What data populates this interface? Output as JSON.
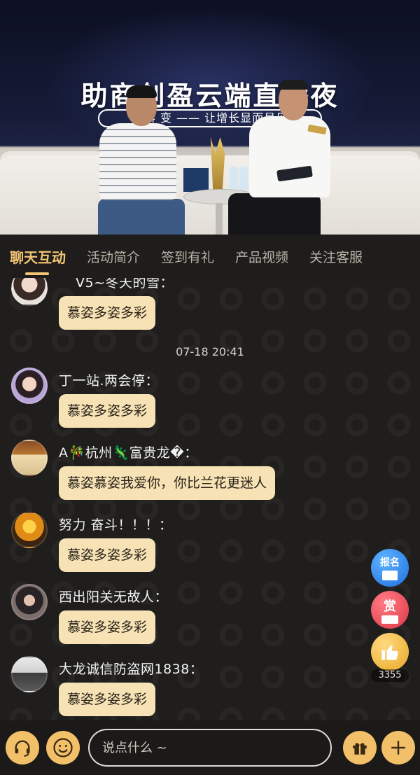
{
  "video": {
    "banner_title": "助商创盈云端直播夜",
    "banner_subtitle": "盈科 变 —— 让增长显而易见"
  },
  "tabs": [
    {
      "label": "聊天互动",
      "active": true
    },
    {
      "label": "活动简介",
      "active": false
    },
    {
      "label": "签到有礼",
      "active": false
    },
    {
      "label": "产品视频",
      "active": false
    },
    {
      "label": "关注客服",
      "active": false
    }
  ],
  "chat": {
    "timestamp": "07-18 20:41",
    "messages": [
      {
        "nick": "V5~冬天的雪：",
        "text": "慕姿多姿多彩"
      },
      {
        "nick": "丁一站.两会停：",
        "text": "慕姿多姿多彩"
      },
      {
        "nick": "A🎋杭州🦎富贵龙�：",
        "text": "慕姿慕姿我爱你，你比兰花更迷人"
      },
      {
        "nick": "努力 奋斗！！！：",
        "text": "慕姿多姿多彩"
      },
      {
        "nick": "西出阳关无故人：",
        "text": "慕姿多姿多彩"
      },
      {
        "nick": "大龙诚信防盗网1838：",
        "text": "慕姿多姿多彩"
      }
    ]
  },
  "side": {
    "signup_label": "报名",
    "reward_label": "赏",
    "like_count": "3355"
  },
  "input": {
    "placeholder": "说点什么 ~"
  },
  "colors": {
    "accent": "#f3c574",
    "bubble": "#f6e2b5",
    "background": "#1f1e1c"
  }
}
